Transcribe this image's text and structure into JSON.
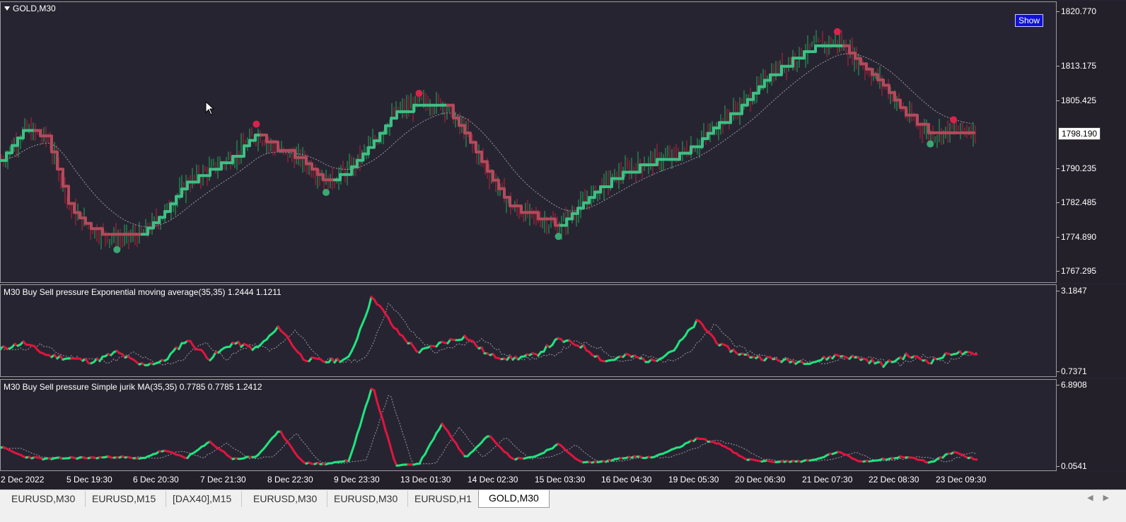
{
  "chart": {
    "symbol": "GOLD,M30",
    "show_button": "Show",
    "current_price": "1798.190",
    "price_ticks": [
      "1820.770",
      "1813.175",
      "1805.425",
      "1798.190",
      "1790.235",
      "1782.485",
      "1774.890",
      "1767.295"
    ]
  },
  "indicator1": {
    "label": "M30 Buy Sell pressure Exponential moving average(35,35) 1.2444 1.1211",
    "axis_max": "3.1847",
    "axis_min": "0.7371"
  },
  "indicator2": {
    "label": "M30 Buy Sell pressure  Simple jurik MA(35,35) 0.7785 0.7785 1.2412",
    "axis_max": "6.8908",
    "axis_min": "0.0541"
  },
  "time_axis": [
    "2 Dec 2022",
    "5 Dec 19:30",
    "6 Dec 20:30",
    "7 Dec 21:30",
    "8 Dec 22:30",
    "9 Dec 23:30",
    "13 Dec 01:30",
    "14 Dec 02:30",
    "15 Dec 03:30",
    "16 Dec 04:30",
    "19 Dec 05:30",
    "20 Dec 06:30",
    "21 Dec 07:30",
    "22 Dec 08:30",
    "23 Dec 09:30"
  ],
  "tabs": [
    "EURUSD,M30",
    "EURUSD,M15",
    "[DAX40],M15",
    "EURUSD,M30",
    "EURUSD,M30",
    "EURUSD,H1",
    "GOLD,M30"
  ],
  "active_tab": "GOLD,M30",
  "colors": {
    "background": "#272431",
    "bull": "#1fe57f",
    "bear": "#e0153f",
    "ma_green": "#3fbf85",
    "ma_red": "#b34a5c"
  },
  "chart_data": {
    "type": "line",
    "series": [
      {
        "name": "",
        "values": [
          1791,
          1798,
          1796,
          1780,
          1775,
          1773,
          1774,
          1779,
          1786,
          1789,
          1792,
          1797,
          1793,
          1791,
          1786,
          1789,
          1795,
          1802,
          1804,
          1804,
          1797,
          1788,
          1780,
          1778,
          1776,
          1781,
          1786,
          1789,
          1791,
          1792,
          1795,
          1800,
          1804,
          1810,
          1814,
          1817,
          1818,
          1813,
          1808,
          1801,
          1797,
          1798,
          1798
        ]
      },
      {
        "name": "",
        "values": [
          1.4,
          1.6,
          1.2,
          1.1,
          1.0,
          1.3,
          0.9,
          1.0,
          1.7,
          1.1,
          1.6,
          1.4,
          2.1,
          1.1,
          1.0,
          1.1,
          3.1,
          2.0,
          1.3,
          1.6,
          1.8,
          1.2,
          1.1,
          1.2,
          1.7,
          1.5,
          1.0,
          1.2,
          1.0,
          1.4,
          2.3,
          1.5,
          1.2,
          1.1,
          1.0,
          1.0,
          1.2,
          1.1,
          0.9,
          1.2,
          1.0,
          1.3,
          1.2
        ]
      },
      {
        "name": "",
        "values": [
          1.8,
          1.0,
          0.8,
          0.9,
          0.9,
          1.0,
          0.8,
          1.5,
          0.9,
          2.2,
          0.8,
          1.0,
          3.1,
          0.5,
          0.4,
          0.7,
          6.8,
          0.3,
          0.4,
          3.7,
          0.9,
          2.8,
          0.8,
          1.0,
          2.0,
          0.5,
          0.6,
          1.0,
          0.9,
          1.6,
          2.5,
          2.0,
          0.8,
          0.6,
          0.6,
          0.7,
          1.4,
          0.6,
          0.8,
          1.0,
          0.5,
          1.4,
          0.7
        ]
      }
    ]
  }
}
